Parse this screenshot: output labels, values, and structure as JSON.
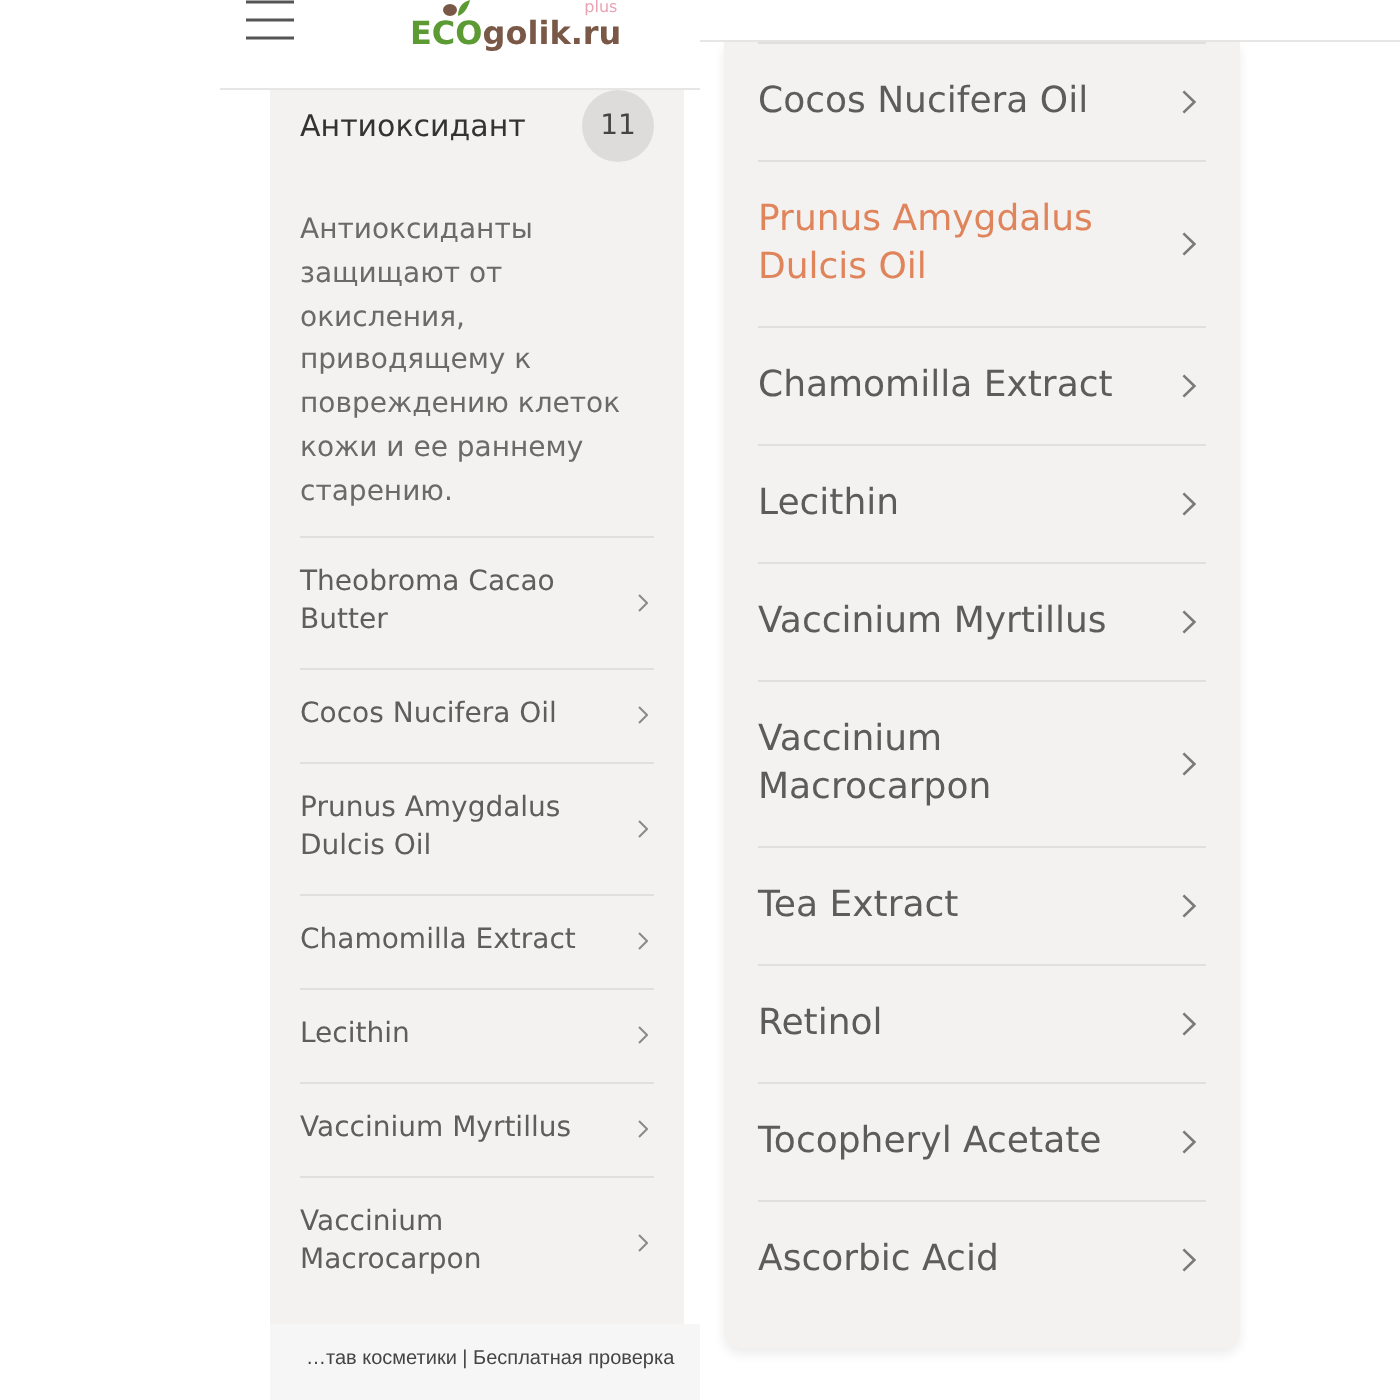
{
  "header": {
    "logo": {
      "tag": "plus",
      "wordmark_parts": [
        "ECO",
        "golik.ru"
      ]
    }
  },
  "category_card": {
    "title": "Антиоксидант",
    "count": "11",
    "description": "Антиоксиданты защищают от окисления, приводящему к повреждению клеток кожи и ее раннему старению.",
    "ingredients": [
      {
        "name": "Theobroma Cacao Butter",
        "selected": false
      },
      {
        "name": "Cocos Nucifera Oil",
        "selected": false
      },
      {
        "name": "Prunus Amygdalus Dulcis Oil",
        "selected": false
      },
      {
        "name": "Chamomilla Extract",
        "selected": false
      },
      {
        "name": "Lecithin",
        "selected": false
      },
      {
        "name": "Vaccinium Myrtillus",
        "selected": false
      },
      {
        "name": "Vaccinium Macrocarpon",
        "selected": false
      }
    ]
  },
  "bottom_bar": {
    "text": "…тав косметики | Бесплатная проверка"
  },
  "zoomed_view": {
    "ingredients": [
      {
        "name": "Cocos Nucifera Oil",
        "selected": false
      },
      {
        "name": "Prunus Amygdalus Dulcis Oil",
        "selected": true
      },
      {
        "name": "Chamomilla Extract",
        "selected": false
      },
      {
        "name": "Lecithin",
        "selected": false
      },
      {
        "name": "Vaccinium Myrtillus",
        "selected": false
      },
      {
        "name": "Vaccinium Macrocarpon",
        "selected": false
      },
      {
        "name": "Tea Extract",
        "selected": false
      },
      {
        "name": "Retinol",
        "selected": false
      },
      {
        "name": "Tocopheryl Acetate",
        "selected": false
      },
      {
        "name": "Ascorbic Acid",
        "selected": false
      }
    ]
  }
}
